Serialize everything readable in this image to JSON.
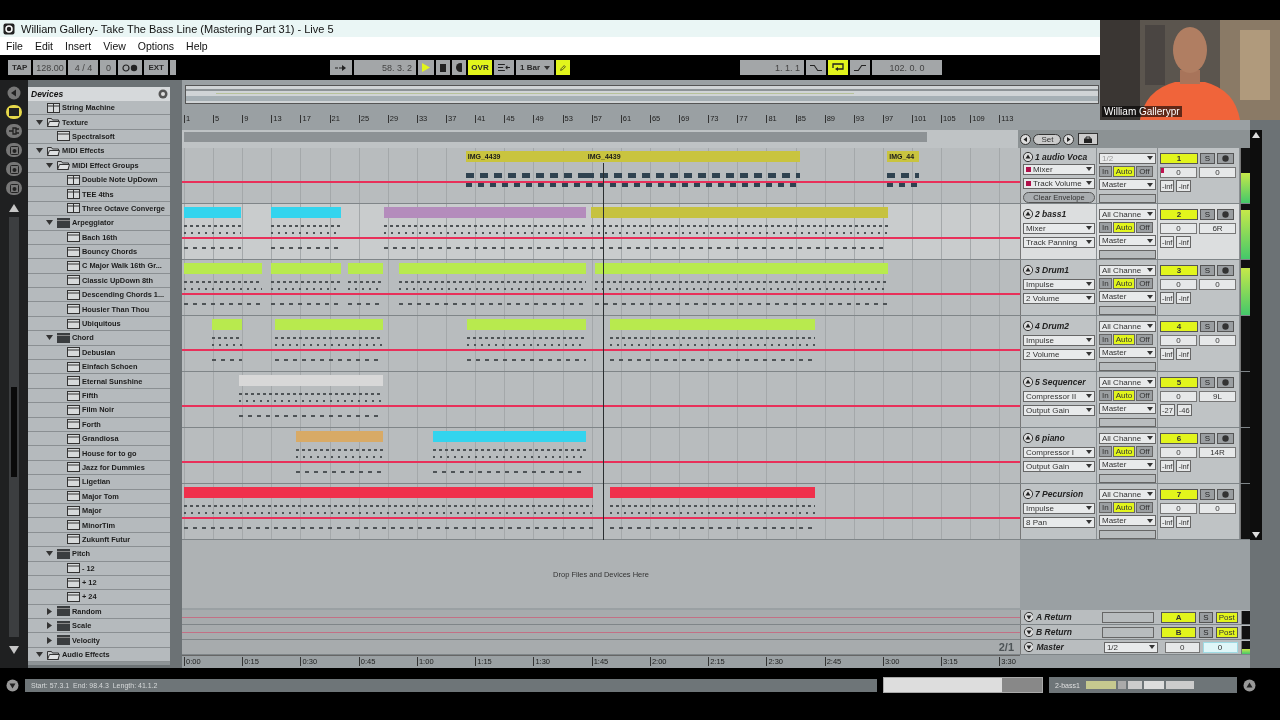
{
  "window": {
    "title": "William Gallery- Take The Bass Line  (Mastering Part 31) - Live 5"
  },
  "menu": [
    "File",
    "Edit",
    "Insert",
    "View",
    "Options",
    "Help"
  ],
  "control_bar": {
    "tap": "TAP",
    "tempo": "128.00",
    "signature": "4 / 4",
    "groove": "0",
    "ext": "EXT",
    "position": "58. 3. 2",
    "playing": true,
    "overdub": "OVR",
    "overdub_on": true,
    "quantize": "1 Bar",
    "draw_mode": true,
    "loop_start": "1. 1. 1",
    "loop_on": true,
    "loop_length": "102. 0. 0"
  },
  "webcam": {
    "name": "William Gallerypr"
  },
  "browser_tabs": [
    {
      "kind": "folder",
      "selected": true
    },
    {
      "kind": "plugin",
      "selected": false
    },
    {
      "kind": "disk",
      "selected": false
    },
    {
      "kind": "disk",
      "selected": false
    },
    {
      "kind": "disk",
      "selected": false
    }
  ],
  "browser": {
    "title": "Devices",
    "items": [
      {
        "label": "String Machine",
        "kind": "rack"
      },
      {
        "label": "Texture",
        "kind": "folder",
        "expanded": true,
        "children": [
          {
            "label": "Spectralsoft",
            "kind": "preset"
          }
        ]
      },
      {
        "label": "MIDI Effects",
        "kind": "folder",
        "expanded": true,
        "children": [
          {
            "label": "MIDI Effect Groups",
            "kind": "folder",
            "expanded": true,
            "children": [
              {
                "label": "Double Note UpDown",
                "kind": "rack"
              },
              {
                "label": "TEE 4ths",
                "kind": "rack"
              },
              {
                "label": "Three Octave Converge",
                "kind": "rack"
              }
            ]
          },
          {
            "label": "Arpeggiator",
            "kind": "device",
            "expanded": true,
            "children": [
              {
                "label": "Bach 16th",
                "kind": "preset"
              },
              {
                "label": "Bouncy Chords",
                "kind": "preset"
              },
              {
                "label": "C Major Walk 16th Gr...",
                "kind": "preset"
              },
              {
                "label": "Classic UpDown 8th",
                "kind": "preset"
              },
              {
                "label": "Descending Chords 1...",
                "kind": "preset"
              },
              {
                "label": "Housier Than Thou",
                "kind": "preset"
              },
              {
                "label": "Ubiquitous",
                "kind": "preset"
              }
            ]
          },
          {
            "label": "Chord",
            "kind": "device",
            "expanded": true,
            "children": [
              {
                "label": "Debusian",
                "kind": "preset"
              },
              {
                "label": "Einfach Schoen",
                "kind": "preset"
              },
              {
                "label": "Eternal Sunshine",
                "kind": "preset"
              },
              {
                "label": "Fifth",
                "kind": "preset"
              },
              {
                "label": "Film Noir",
                "kind": "preset"
              },
              {
                "label": "Forth",
                "kind": "preset"
              },
              {
                "label": "Grandiosa",
                "kind": "preset"
              },
              {
                "label": "House for to go",
                "kind": "preset"
              },
              {
                "label": "Jazz for Dummies",
                "kind": "preset"
              },
              {
                "label": "Ligetian",
                "kind": "preset"
              },
              {
                "label": "Major Tom",
                "kind": "preset"
              },
              {
                "label": "Major",
                "kind": "preset"
              },
              {
                "label": "MinorTim",
                "kind": "preset"
              },
              {
                "label": "Zukunft Futur",
                "kind": "preset"
              }
            ]
          },
          {
            "label": "Pitch",
            "kind": "device",
            "expanded": true,
            "children": [
              {
                "label": "- 12",
                "kind": "preset"
              },
              {
                "label": "+ 12",
                "kind": "preset"
              },
              {
                "label": "+ 24",
                "kind": "preset"
              }
            ]
          },
          {
            "label": "Random",
            "kind": "device",
            "expanded": false
          },
          {
            "label": "Scale",
            "kind": "device",
            "expanded": false
          },
          {
            "label": "Velocity",
            "kind": "device",
            "expanded": false
          }
        ]
      },
      {
        "label": "Audio Effects",
        "kind": "folder",
        "expanded": true
      }
    ]
  },
  "ruler": {
    "bars": [
      "1",
      "5",
      "9",
      "13",
      "17",
      "21",
      "25",
      "29",
      "33",
      "37",
      "41",
      "45",
      "49",
      "53",
      "57",
      "61",
      "65",
      "69",
      "73",
      "77",
      "81",
      "85",
      "89",
      "93",
      "97",
      "101",
      "105",
      "109",
      "113"
    ],
    "time": [
      "0:00",
      "0:15",
      "0:30",
      "0:45",
      "1:00",
      "1:15",
      "1:30",
      "1:45",
      "2:00",
      "2:15",
      "2:30",
      "2:45",
      "3:00",
      "3:15",
      "3:30"
    ]
  },
  "set_button": "Set",
  "tracks": [
    {
      "number": "1",
      "name": "1 audio Voca",
      "selected": false,
      "active": true,
      "automated": true,
      "device": "Mixer",
      "parameter": "Track Volume",
      "input": "1/2",
      "input_disabled": true,
      "monitor": [
        {
          "label": "In",
          "selected": false
        },
        {
          "label": "Auto",
          "selected": true
        },
        {
          "label": "Off",
          "selected": false
        }
      ],
      "output": "Master",
      "solo": "S",
      "volume": "0",
      "pan": "0",
      "peaks": [
        "-inf",
        "-inf"
      ],
      "meter": {
        "level": 0.55
      },
      "clear_envelope": "Clear Envelope",
      "clips": [
        {
          "name": "IMG_4439",
          "kind": "audio",
          "color": "#c9c43f"
        },
        {
          "name": "IMG_4439",
          "kind": "audio",
          "color": "#c9c43f"
        },
        {
          "name": "IMG_44",
          "kind": "audio",
          "color": "#c9c43f"
        }
      ]
    },
    {
      "number": "2",
      "name": "2 bass1",
      "selected": true,
      "active": true,
      "automated": false,
      "device": "Mixer",
      "parameter": "Track Panning",
      "input": "All Channe",
      "input_disabled": false,
      "monitor": [
        {
          "label": "In",
          "selected": false
        },
        {
          "label": "Auto",
          "selected": true
        },
        {
          "label": "Off",
          "selected": false
        }
      ],
      "output": "Master",
      "solo": "S",
      "volume": "0",
      "pan": "6R",
      "peaks": [
        "-inf",
        "-inf"
      ],
      "meter": {
        "level": 0.9
      },
      "clips": [
        {
          "kind": "midi",
          "color": "#33d4ee"
        },
        {
          "kind": "midi",
          "color": "#33d4ee"
        },
        {
          "kind": "midi",
          "color": "#b48cbc"
        },
        {
          "kind": "midi",
          "color": "#c6c240"
        }
      ]
    },
    {
      "number": "3",
      "name": "3 Drum1",
      "selected": false,
      "active": true,
      "automated": false,
      "device": "Impulse",
      "parameter": "2 Volume",
      "input": "All Channe",
      "input_disabled": false,
      "monitor": [
        {
          "label": "In",
          "selected": false
        },
        {
          "label": "Auto",
          "selected": true
        },
        {
          "label": "Off",
          "selected": false
        }
      ],
      "output": "Master",
      "solo": "S",
      "volume": "0",
      "pan": "0",
      "peaks": [
        "-inf",
        "-inf"
      ],
      "meter": {
        "level": 0.85
      },
      "clips": [
        {
          "kind": "midi",
          "color": "#b8ea4e"
        },
        {
          "kind": "midi",
          "color": "#b8ea4e"
        },
        {
          "kind": "midi",
          "color": "#b8ea4e"
        },
        {
          "kind": "midi",
          "color": "#b8ea4e"
        },
        {
          "kind": "midi",
          "color": "#b8ea4e"
        }
      ]
    },
    {
      "number": "4",
      "name": "4 Drum2",
      "selected": false,
      "active": true,
      "automated": false,
      "device": "Impulse",
      "parameter": "2 Volume",
      "input": "All Channe",
      "input_disabled": false,
      "monitor": [
        {
          "label": "In",
          "selected": false
        },
        {
          "label": "Auto",
          "selected": true
        },
        {
          "label": "Off",
          "selected": false
        }
      ],
      "output": "Master",
      "solo": "S",
      "volume": "0",
      "pan": "0",
      "peaks": [
        "-inf",
        "-inf"
      ],
      "meter": {
        "level": 0
      },
      "clips": [
        {
          "kind": "midi",
          "color": "#b8ea4e"
        },
        {
          "kind": "midi",
          "color": "#b8ea4e"
        },
        {
          "kind": "midi",
          "color": "#b8ea4e"
        },
        {
          "kind": "midi",
          "color": "#b8ea4e"
        }
      ]
    },
    {
      "number": "5",
      "name": "5 Sequencer",
      "selected": false,
      "active": true,
      "automated": false,
      "device": "Compressor II",
      "parameter": "Output Gain",
      "input": "All Channe",
      "input_disabled": false,
      "monitor": [
        {
          "label": "In",
          "selected": false
        },
        {
          "label": "Auto",
          "selected": true
        },
        {
          "label": "Off",
          "selected": false
        }
      ],
      "output": "Master",
      "solo": "S",
      "volume": "0",
      "pan": "9L",
      "peaks": [
        "-27",
        "-46"
      ],
      "meter": {
        "level": 0
      },
      "clips": [
        {
          "kind": "midi",
          "color": "#d8d8d8"
        }
      ]
    },
    {
      "number": "6",
      "name": "6 piano",
      "selected": false,
      "active": true,
      "automated": false,
      "device": "Compressor I",
      "parameter": "Output Gain",
      "input": "All Channe",
      "input_disabled": false,
      "monitor": [
        {
          "label": "In",
          "selected": false
        },
        {
          "label": "Auto",
          "selected": true
        },
        {
          "label": "Off",
          "selected": false
        }
      ],
      "output": "Master",
      "solo": "S",
      "volume": "0",
      "pan": "14R",
      "peaks": [
        "-inf",
        "-inf"
      ],
      "meter": {
        "level": 0
      },
      "clips": [
        {
          "kind": "midi",
          "color": "#d8aa66"
        },
        {
          "kind": "midi",
          "color": "#33d4ee"
        }
      ]
    },
    {
      "number": "7",
      "name": "7 Pecursion",
      "selected": false,
      "active": true,
      "automated": false,
      "device": "Impulse",
      "parameter": "8 Pan",
      "input": "All Channe",
      "input_disabled": false,
      "monitor": [
        {
          "label": "In",
          "selected": false
        },
        {
          "label": "Auto",
          "selected": true
        },
        {
          "label": "Off",
          "selected": false
        }
      ],
      "output": "Master",
      "solo": "S",
      "volume": "0",
      "pan": "0",
      "peaks": [
        "-inf",
        "-inf"
      ],
      "meter": {
        "level": 0
      },
      "clips": [
        {
          "kind": "midi",
          "color": "#f0304c"
        },
        {
          "kind": "midi",
          "color": "#f0304c"
        }
      ]
    }
  ],
  "drop_hint": "Drop Files and Devices Here",
  "returns": [
    {
      "name": "A Return",
      "letter": "A",
      "solo": "S",
      "post": "Post"
    },
    {
      "name": "B Return",
      "letter": "B",
      "solo": "S",
      "post": "Post"
    }
  ],
  "master": {
    "name": "Master",
    "input": "1/2",
    "volume": "0",
    "pan": "0",
    "meter": {
      "level": 0.35
    }
  },
  "zoom_label": "2/1",
  "status": {
    "text": "Start: 57.3.1  End: 98.4.3  Length: 41.1.2",
    "selected_track": "2-bass1"
  }
}
